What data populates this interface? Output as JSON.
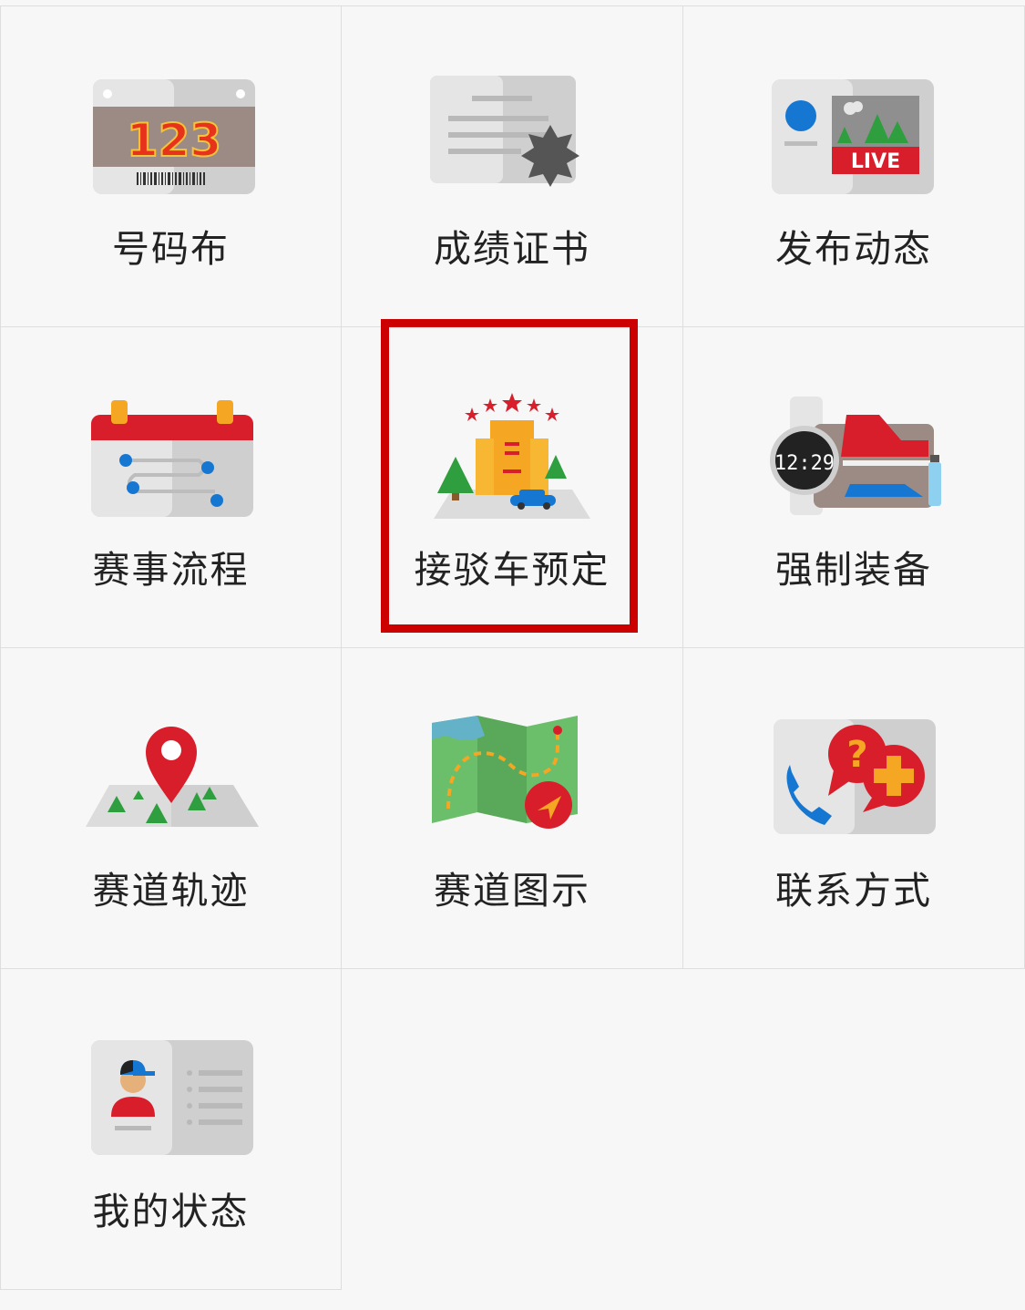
{
  "grid": {
    "items": [
      {
        "label": "号码布",
        "icon": "race-bib-icon"
      },
      {
        "label": "成绩证书",
        "icon": "certificate-icon"
      },
      {
        "label": "发布动态",
        "icon": "live-post-icon"
      },
      {
        "label": "赛事流程",
        "icon": "calendar-schedule-icon"
      },
      {
        "label": "接驳车预定",
        "icon": "shuttle-booking-icon"
      },
      {
        "label": "强制装备",
        "icon": "mandatory-gear-icon"
      },
      {
        "label": "赛道轨迹",
        "icon": "map-pin-track-icon"
      },
      {
        "label": "赛道图示",
        "icon": "route-map-icon"
      },
      {
        "label": "联系方式",
        "icon": "contact-phone-icon"
      },
      {
        "label": "我的状态",
        "icon": "profile-card-icon"
      }
    ],
    "highlighted_index": 4
  },
  "bib": {
    "number": "123"
  },
  "live": {
    "badge": "LIVE"
  },
  "watch": {
    "time": "12:29"
  },
  "colors": {
    "accent_red": "#d81e2b",
    "highlight_border": "#cc0000",
    "card_gray": "#dcdcdc",
    "blue": "#1677d2"
  }
}
